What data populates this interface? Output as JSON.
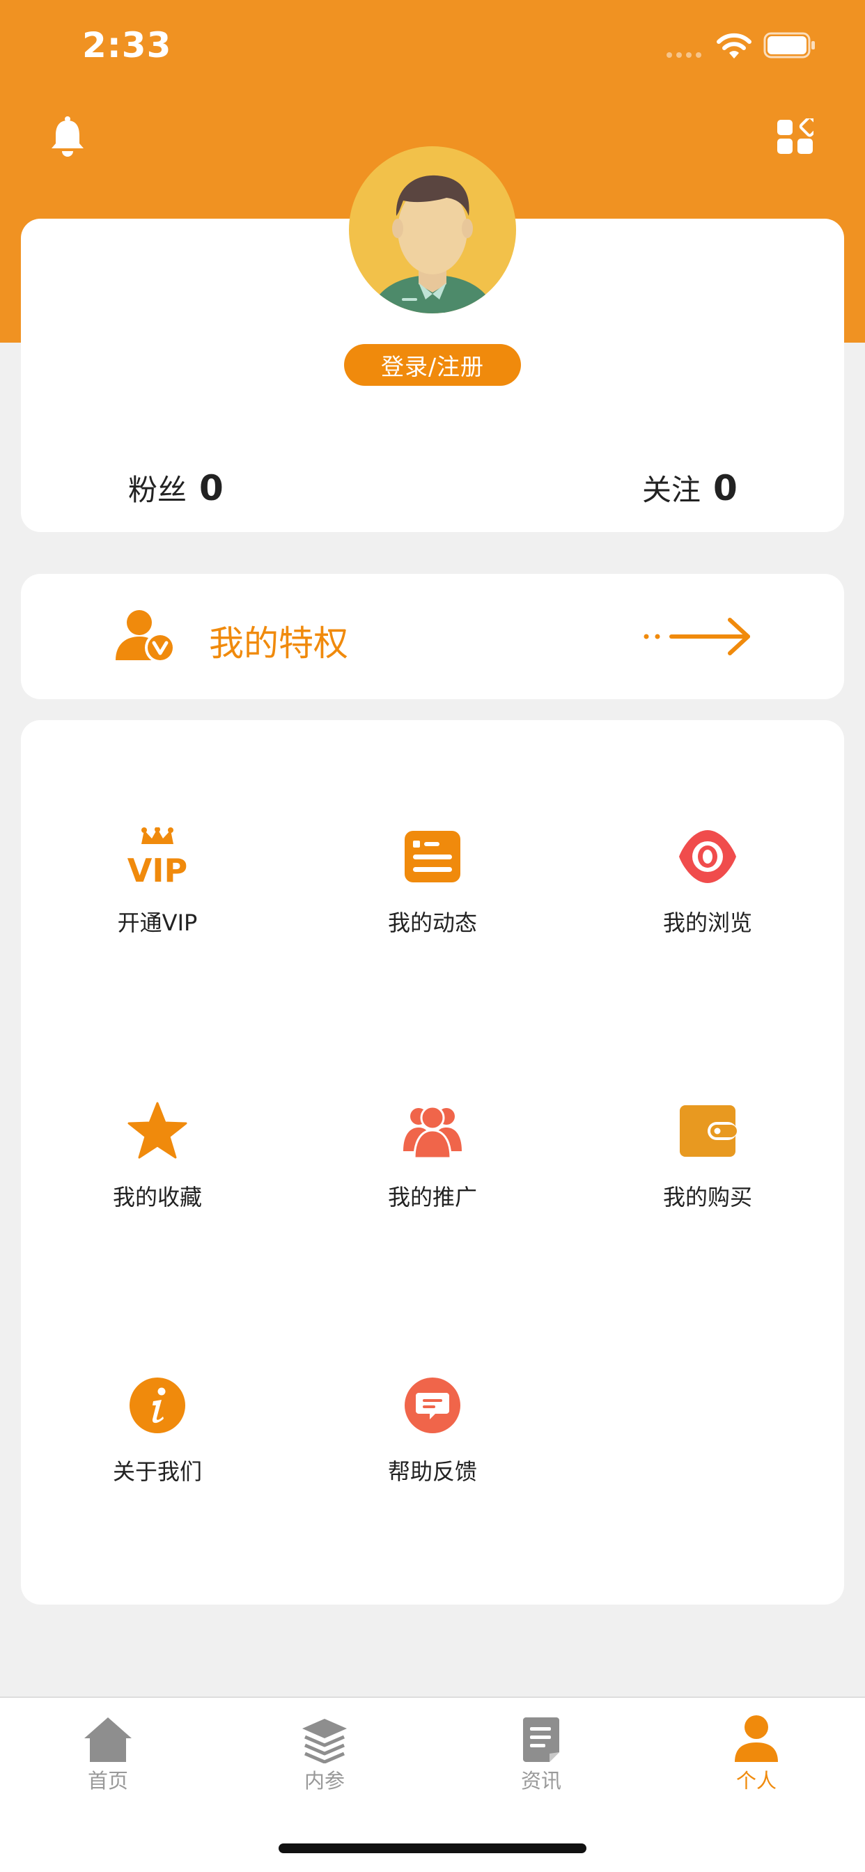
{
  "status_bar": {
    "time": "2:33"
  },
  "profile": {
    "login_button": "登录/注册",
    "fans_label": "粉丝",
    "fans_count": "0",
    "follow_label": "关注",
    "follow_count": "0"
  },
  "privilege": {
    "label": "我的特权"
  },
  "menu": {
    "items": [
      {
        "label": "开通VIP",
        "icon": "vip-crown-icon"
      },
      {
        "label": "我的动态",
        "icon": "news-card-icon"
      },
      {
        "label": "我的浏览",
        "icon": "eye-icon"
      },
      {
        "label": "我的收藏",
        "icon": "star-icon"
      },
      {
        "label": "我的推广",
        "icon": "people-group-icon"
      },
      {
        "label": "我的购买",
        "icon": "wallet-icon"
      },
      {
        "label": "关于我们",
        "icon": "info-icon"
      },
      {
        "label": "帮助反馈",
        "icon": "chat-bubble-icon"
      }
    ]
  },
  "tabbar": {
    "tabs": [
      {
        "label": "首页",
        "icon": "home-icon"
      },
      {
        "label": "内参",
        "icon": "layers-icon"
      },
      {
        "label": "资讯",
        "icon": "document-icon"
      },
      {
        "label": "个人",
        "icon": "person-icon",
        "active": true
      }
    ]
  },
  "colors": {
    "brand_orange": "#f09222",
    "accent_orange": "#f08a0c",
    "coral": "#f0654a",
    "inactive_gray": "#999999"
  }
}
